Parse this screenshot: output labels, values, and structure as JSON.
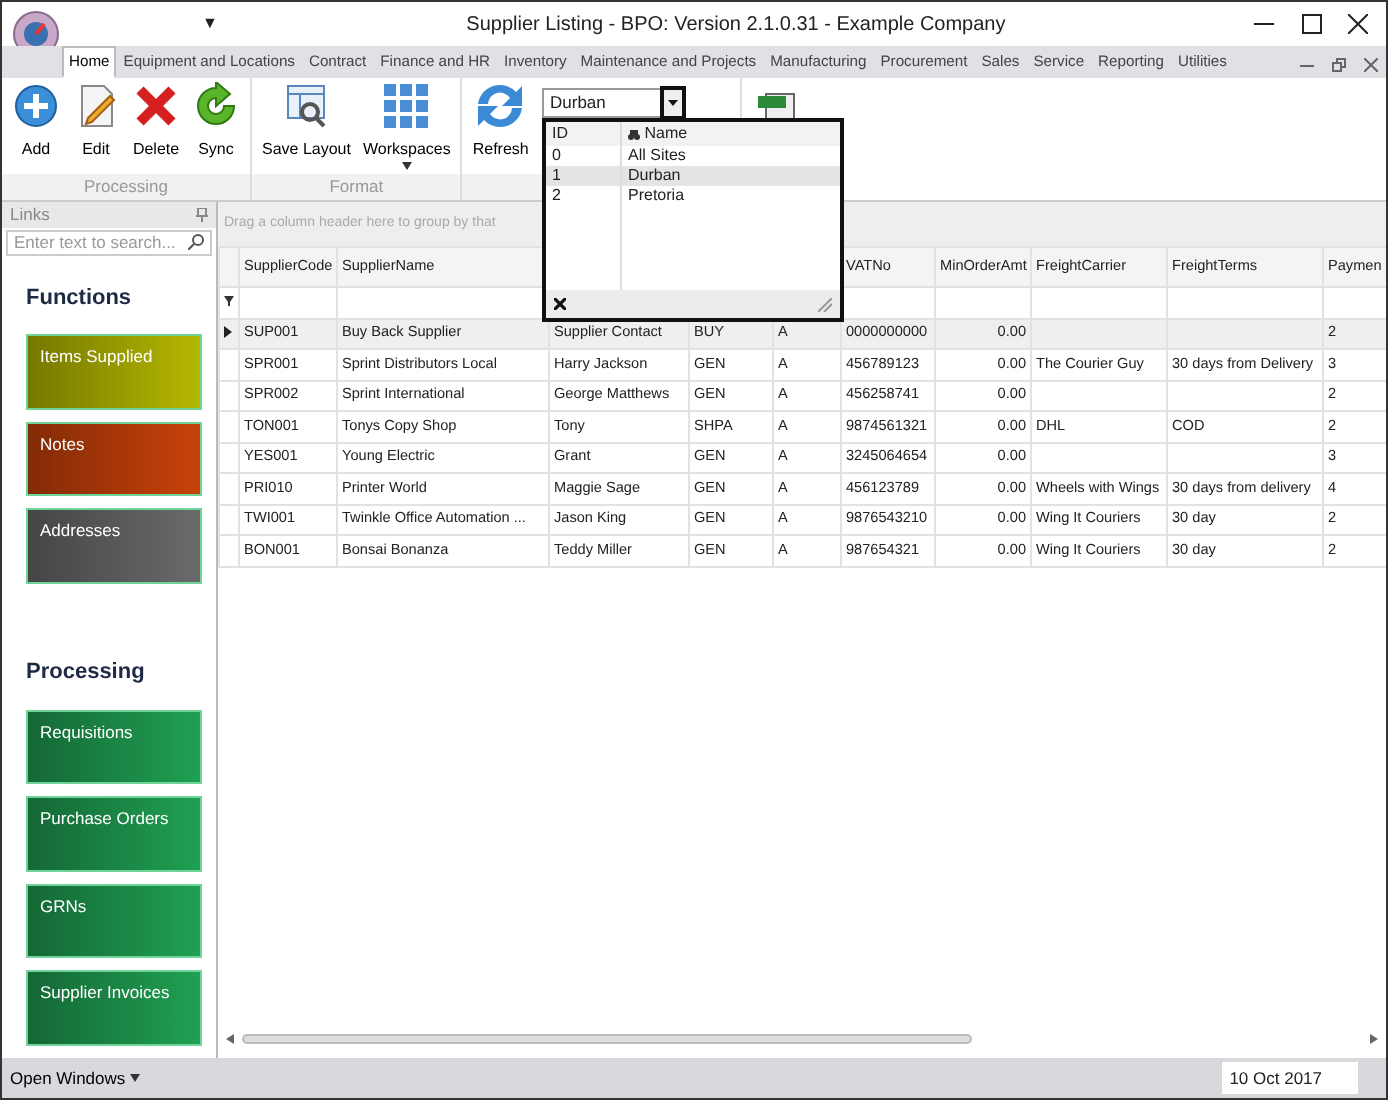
{
  "window": {
    "title": "Supplier Listing - BPO: Version 2.1.0.31 - Example Company",
    "quick_access": "▼"
  },
  "ribbon_tabs": [
    {
      "label": "Home",
      "selected": true
    },
    {
      "label": "Equipment and Locations",
      "selected": false
    },
    {
      "label": "Contract",
      "selected": false
    },
    {
      "label": "Finance and HR",
      "selected": false
    },
    {
      "label": "Inventory",
      "selected": false
    },
    {
      "label": "Maintenance and Projects",
      "selected": false
    },
    {
      "label": "Manufacturing",
      "selected": false
    },
    {
      "label": "Procurement",
      "selected": false
    },
    {
      "label": "Sales",
      "selected": false
    },
    {
      "label": "Service",
      "selected": false
    },
    {
      "label": "Reporting",
      "selected": false
    },
    {
      "label": "Utilities",
      "selected": false
    }
  ],
  "ribbon_groups": [
    {
      "label": "Processing",
      "buttons": [
        {
          "label": "Add",
          "kind": "add"
        },
        {
          "label": "Edit",
          "kind": "edit"
        },
        {
          "label": "Delete",
          "kind": "delete"
        },
        {
          "label": "Sync",
          "kind": "sync"
        }
      ]
    },
    {
      "label": "Format",
      "buttons": [
        {
          "label": "Save Layout",
          "kind": "layout"
        },
        {
          "label": "Workspaces",
          "kind": "workspaces"
        }
      ]
    },
    {
      "buttons": [
        {
          "label": "Refresh",
          "kind": "refresh"
        }
      ]
    }
  ],
  "site_selector": {
    "value": "Durban",
    "columns": [
      "ID",
      "Name"
    ],
    "rows": [
      {
        "id": "0",
        "name": "All Sites",
        "selected": false
      },
      {
        "id": "1",
        "name": "Durban",
        "selected": true
      },
      {
        "id": "2",
        "name": "Pretoria",
        "selected": false
      }
    ]
  },
  "sidebar": {
    "title": "Links",
    "search_placeholder": "Enter text to search...",
    "sections": [
      {
        "heading": "Functions",
        "tiles": [
          {
            "label": "Items Supplied",
            "color": "#b5b800"
          },
          {
            "label": "Notes",
            "color": "#c8420a"
          },
          {
            "label": "Addresses",
            "color": "#6a6a6a"
          }
        ]
      },
      {
        "heading": "Processing",
        "tiles": [
          {
            "label": "Requisitions",
            "color": "#1fa052"
          },
          {
            "label": "Purchase Orders",
            "color": "#1fa052"
          },
          {
            "label": "GRNs",
            "color": "#1fa052"
          },
          {
            "label": "Supplier Invoices",
            "color": "#1fa052"
          }
        ]
      }
    ]
  },
  "grid": {
    "group_hint": "Drag a column header here to group by that",
    "columns": [
      "SupplierCode",
      "SupplierName",
      "",
      "",
      "",
      "VATNo",
      "MinOrderAmt",
      "FreightCarrier",
      "FreightTerms",
      "Paymen"
    ],
    "rows": [
      {
        "current": true,
        "cells": [
          "SUP001",
          "Buy Back Supplier",
          "Supplier Contact",
          "BUY",
          "A",
          "0000000000",
          "0.00",
          "",
          "",
          "2"
        ]
      },
      {
        "current": false,
        "cells": [
          "SPR001",
          "Sprint Distributors Local",
          "Harry Jackson",
          "GEN",
          "A",
          "456789123",
          "0.00",
          "The Courier Guy",
          "30 days from Delivery",
          "3"
        ]
      },
      {
        "current": false,
        "cells": [
          "SPR002",
          "Sprint International",
          "George Matthews",
          "GEN",
          "A",
          "456258741",
          "0.00",
          "",
          "",
          "2"
        ]
      },
      {
        "current": false,
        "cells": [
          "TON001",
          "Tonys Copy Shop",
          "Tony",
          "SHPA",
          "A",
          "9874561321",
          "0.00",
          "DHL",
          "COD",
          "2"
        ]
      },
      {
        "current": false,
        "cells": [
          "YES001",
          "Young Electric",
          "Grant",
          "GEN",
          "A",
          "3245064654",
          "0.00",
          "",
          "",
          "3"
        ]
      },
      {
        "current": false,
        "cells": [
          "PRI010",
          "Printer World",
          "Maggie Sage",
          "GEN",
          "A",
          "456123789",
          "0.00",
          "Wheels with Wings",
          "30 days from delivery",
          "4"
        ]
      },
      {
        "current": false,
        "cells": [
          "TWI001",
          "Twinkle Office Automation ...",
          "Jason King",
          "GEN",
          "A",
          "9876543210",
          "0.00",
          "Wing It Couriers",
          "30 day",
          "2"
        ]
      },
      {
        "current": false,
        "cells": [
          "BON001",
          "Bonsai Bonanza",
          "Teddy Miller",
          "GEN",
          "A",
          "987654321",
          "0.00",
          "Wing It Couriers",
          "30 day",
          "2"
        ]
      }
    ]
  },
  "status_bar": {
    "open_windows": "Open Windows",
    "date": "10 Oct 2017"
  }
}
